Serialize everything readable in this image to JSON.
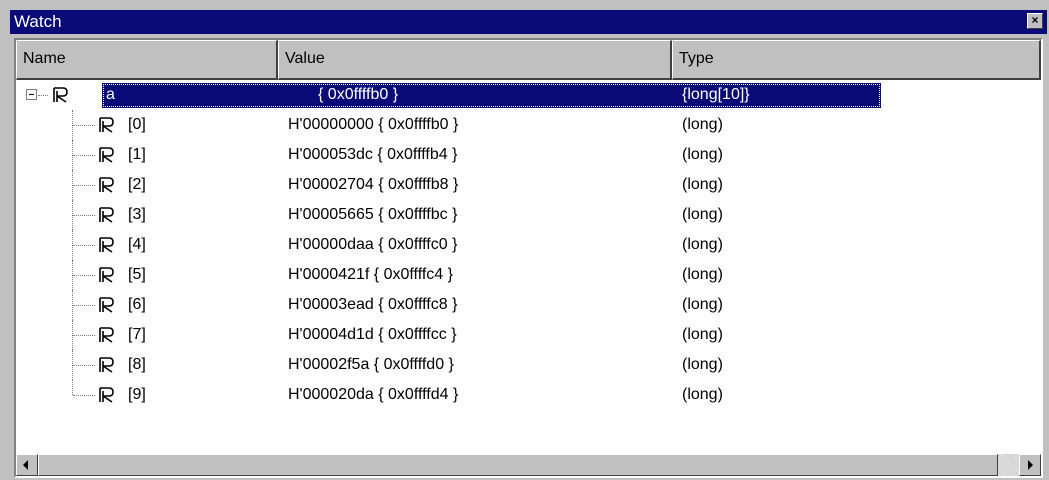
{
  "window": {
    "title": "Watch",
    "close_glyph": "×"
  },
  "columns": [
    {
      "label": "Name"
    },
    {
      "label": "Value"
    },
    {
      "label": "Type"
    }
  ],
  "rows": [
    {
      "name": "a",
      "value": "{ 0x0ffffb0 }",
      "type": "{long[10]}",
      "selected": true,
      "expanded": true
    },
    {
      "name": "[0]",
      "value": "H'00000000 { 0x0ffffb0 }",
      "type": "(long)"
    },
    {
      "name": "[1]",
      "value": "H'000053dc { 0x0ffffb4 }",
      "type": "(long)"
    },
    {
      "name": "[2]",
      "value": "H'00002704 { 0x0ffffb8 }",
      "type": "(long)"
    },
    {
      "name": "[3]",
      "value": "H'00005665 { 0x0ffffbc }",
      "type": "(long)"
    },
    {
      "name": "[4]",
      "value": "H'00000daa { 0x0ffffc0 }",
      "type": "(long)"
    },
    {
      "name": "[5]",
      "value": "H'0000421f { 0x0ffffc4 }",
      "type": "(long)"
    },
    {
      "name": "[6]",
      "value": "H'00003ead { 0x0ffffc8 }",
      "type": "(long)"
    },
    {
      "name": "[7]",
      "value": "H'00004d1d { 0x0ffffcc }",
      "type": "(long)"
    },
    {
      "name": "[8]",
      "value": "H'00002f5a { 0x0ffffd0 }",
      "type": "(long)"
    },
    {
      "name": "[9]",
      "value": "H'000020da { 0x0ffffd4 }",
      "type": "(long)"
    }
  ],
  "icons": {
    "register": "register-icon",
    "expander": "tree-collapse-icon"
  },
  "colors": {
    "titlebar": "#0a0a78",
    "selection": "#0a0a78",
    "face": "#c0c0c0"
  }
}
